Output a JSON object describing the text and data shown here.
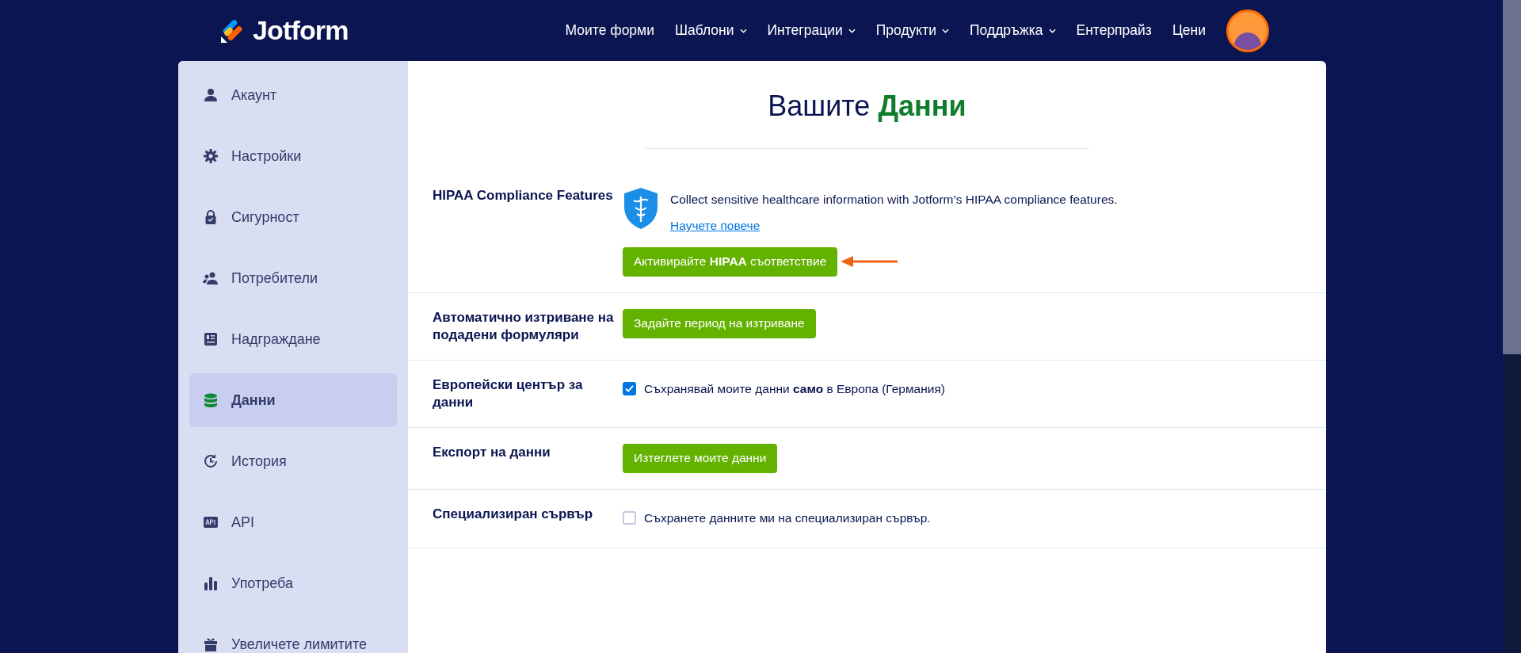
{
  "header": {
    "logo": "Jotform",
    "nav": [
      {
        "label": "Моите форми",
        "has_caret": false
      },
      {
        "label": "Шаблони",
        "has_caret": true
      },
      {
        "label": "Интеграции",
        "has_caret": true
      },
      {
        "label": "Продукти",
        "has_caret": true
      },
      {
        "label": "Поддръжка",
        "has_caret": true
      },
      {
        "label": "Ентерпрайз",
        "has_caret": false
      },
      {
        "label": "Цени",
        "has_caret": false
      }
    ]
  },
  "sidebar": {
    "items": [
      {
        "label": "Акаунт",
        "selected": false
      },
      {
        "label": "Настройки",
        "selected": false
      },
      {
        "label": "Сигурност",
        "selected": false
      },
      {
        "label": "Потребители",
        "selected": false
      },
      {
        "label": "Надграждане",
        "selected": false
      },
      {
        "label": "Данни",
        "selected": true
      },
      {
        "label": "История",
        "selected": false
      },
      {
        "label": "API",
        "selected": false
      },
      {
        "label": "Употреба",
        "selected": false
      },
      {
        "label": "Увеличете лимитите",
        "selected": false
      }
    ]
  },
  "page": {
    "title": "Вашите",
    "title_highlight": "Данни"
  },
  "sections": [
    {
      "kind": "hipaa",
      "label": "HIPAA Compliance Features",
      "description": "Collect sensitive healthcare information with Jotform’s HIPAA compliance features.",
      "link": "Научете повече",
      "button": "Активирайте **HIPAA** съответствие"
    },
    {
      "kind": "button",
      "label": "Автоматично изтриване на подадени формуляри",
      "button": "Задайте период на изтриване"
    },
    {
      "kind": "checkbox",
      "label": "Европейски център за данни",
      "text": "Съхранявай моите данни **само** в Европа (Германия)",
      "checked": true
    },
    {
      "kind": "button",
      "label": "Експорт на данни",
      "button": "Изтеглете моите данни"
    },
    {
      "kind": "checkbox",
      "label": "Специализиран сървър",
      "text": "Съхранете данните ми на специализиран сървър.",
      "checked": false
    }
  ]
}
